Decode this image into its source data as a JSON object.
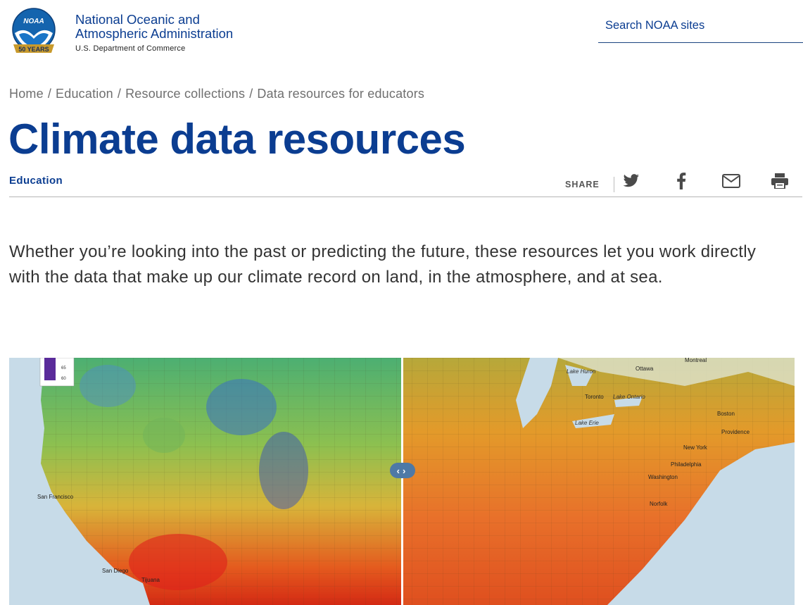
{
  "header": {
    "logo_text": "NOAA",
    "logo_badge": "50 YEARS",
    "org_line1": "National Oceanic and",
    "org_line2": "Atmospheric Administration",
    "org_dept": "U.S. Department of Commerce",
    "search_placeholder": "Search NOAA sites"
  },
  "breadcrumb": {
    "items": [
      "Home",
      "Education",
      "Resource collections",
      "Data resources for educators"
    ],
    "separator": "/"
  },
  "page": {
    "title": "Climate data resources",
    "topic": "Education",
    "share_label": "SHARE",
    "share_icons": [
      "twitter-icon",
      "facebook-icon",
      "email-icon",
      "print-icon"
    ],
    "intro": "Whether you’re looking into the past or predicting the future, these resources let you work directly with the data that make up our climate record on land, in the atmosphere, and at sea."
  },
  "map": {
    "legend_ticks": [
      "65",
      "60"
    ],
    "city_labels_left": [
      "San Francisco",
      "San Diego",
      "Tijuana"
    ],
    "city_labels_right": [
      "Montreal",
      "Ottawa",
      "Lake Huron",
      "Toronto",
      "Lake Ontario",
      "Lake Erie",
      "Boston",
      "Providence",
      "New York",
      "Philadelphia",
      "Washington",
      "Norfolk"
    ],
    "handle_left": "‹",
    "handle_right": "›"
  },
  "colors": {
    "brand_blue": "#0b3d91",
    "rule_gray": "#b5b5b5"
  }
}
